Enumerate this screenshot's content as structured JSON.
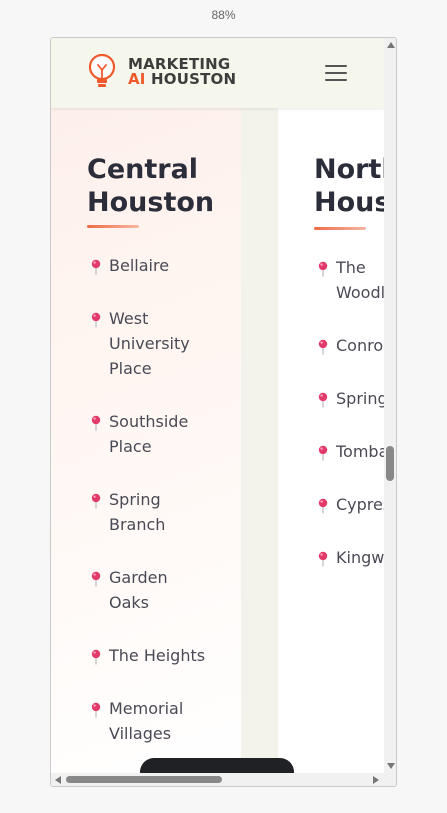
{
  "browser": {
    "zoom_level": "88%"
  },
  "header": {
    "logo_line1": "MARKETING",
    "logo_line2_accent": "AI",
    "logo_line2_rest": " HOUSTON",
    "logo_icon": "lightbulb-icon",
    "menu_icon": "hamburger-menu-icon"
  },
  "regions": [
    {
      "title": "Central\nHouston",
      "locations": [
        {
          "label": "Bellaire"
        },
        {
          "label": "West\nUniversity\nPlace"
        },
        {
          "label": "Southside\nPlace"
        },
        {
          "label": "Spring\nBranch"
        },
        {
          "label": "Garden\nOaks"
        },
        {
          "label": "The Heights"
        },
        {
          "label": "Memorial\nVillages"
        }
      ]
    },
    {
      "title": "North\nHous",
      "locations": [
        {
          "label": "The\nWoodl"
        },
        {
          "label": "Conro"
        },
        {
          "label": "Spring"
        },
        {
          "label": "Tomba"
        },
        {
          "label": "Cypres"
        },
        {
          "label": "Kingw"
        }
      ]
    }
  ],
  "colors": {
    "accent": "#ef5a2c",
    "pin": "#e23b6a",
    "heading": "#2c2d3a",
    "header_bg": "#f6f7ec"
  }
}
